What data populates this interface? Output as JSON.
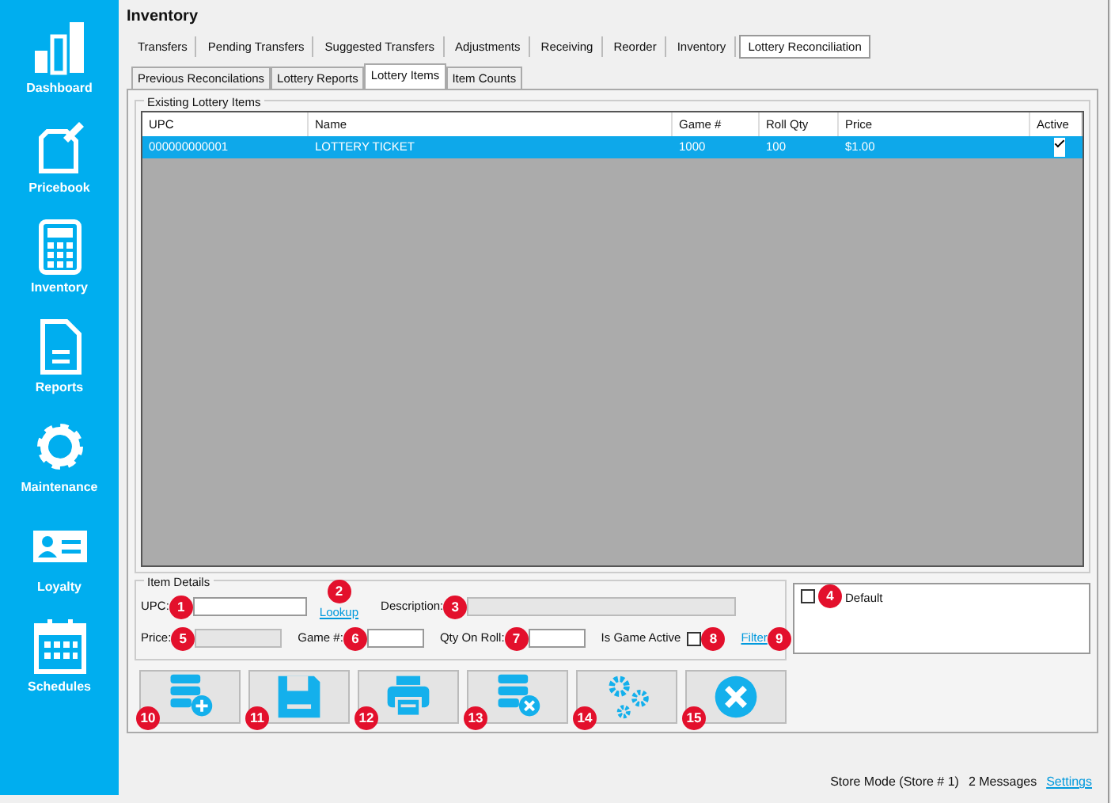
{
  "sidebar": {
    "items": [
      {
        "label": "Dashboard",
        "kind": "dashboard"
      },
      {
        "label": "Pricebook",
        "kind": "pricebook"
      },
      {
        "label": "Inventory",
        "kind": "inventory"
      },
      {
        "label": "Reports",
        "kind": "reports"
      },
      {
        "label": "Maintenance",
        "kind": "maintenance"
      },
      {
        "label": "Loyalty",
        "kind": "loyalty"
      },
      {
        "label": "Schedules",
        "kind": "schedules"
      }
    ]
  },
  "title": "Inventory",
  "tabs": [
    {
      "label": "Transfers",
      "selected": false
    },
    {
      "label": "Pending Transfers",
      "selected": false
    },
    {
      "label": "Suggested Transfers",
      "selected": false
    },
    {
      "label": "Adjustments",
      "selected": false
    },
    {
      "label": "Receiving",
      "selected": false
    },
    {
      "label": "Reorder",
      "selected": false
    },
    {
      "label": "Inventory",
      "selected": false
    },
    {
      "label": "Lottery Reconciliation",
      "selected": true
    }
  ],
  "subtabs": [
    {
      "label": "Previous Reconcilations",
      "selected": false
    },
    {
      "label": "Lottery Reports",
      "selected": false
    },
    {
      "label": "Lottery Items",
      "selected": true
    },
    {
      "label": "Item Counts",
      "selected": false
    }
  ],
  "items_group": {
    "title": "Existing Lottery Items",
    "table": {
      "columns": [
        "UPC",
        "Name",
        "Game #",
        "Roll Qty",
        "Price",
        "Active"
      ],
      "rows": [
        {
          "cells": [
            "000000000001",
            "LOTTERY TICKET",
            "1000",
            "100",
            "$1.00"
          ],
          "active": true,
          "selected": true
        }
      ]
    }
  },
  "item_details": {
    "title": "Item Details",
    "upc": {
      "label": "UPC:",
      "marker": "1"
    },
    "lookup": {
      "label": "Lookup",
      "marker": "2"
    },
    "description": {
      "label": "Description:",
      "marker": "3",
      "disabled": true
    },
    "price": {
      "label": "Price:",
      "marker": "5",
      "disabled": true
    },
    "game": {
      "label": "Game #:",
      "marker": "6",
      "disabled": false
    },
    "qty": {
      "label": "Qty On Roll:",
      "marker": "7",
      "disabled": false
    },
    "is_active": {
      "label": "Is Game Active",
      "checked": false,
      "marker": "8"
    },
    "filter": {
      "label": "Filter",
      "marker": "9"
    }
  },
  "filter_list": {
    "items": [
      {
        "label": "Default",
        "checked": false,
        "marker": "4"
      }
    ]
  },
  "buttons": [
    {
      "kind": "add",
      "marker": "10"
    },
    {
      "kind": "save",
      "marker": "11"
    },
    {
      "kind": "print",
      "marker": "12"
    },
    {
      "kind": "delete",
      "marker": "13"
    },
    {
      "kind": "settings",
      "marker": "14"
    },
    {
      "kind": "close",
      "marker": "15"
    }
  ],
  "status_bar": {
    "mode": "Store Mode (Store # 1)",
    "messages": "2 Messages",
    "settings": "Settings"
  }
}
